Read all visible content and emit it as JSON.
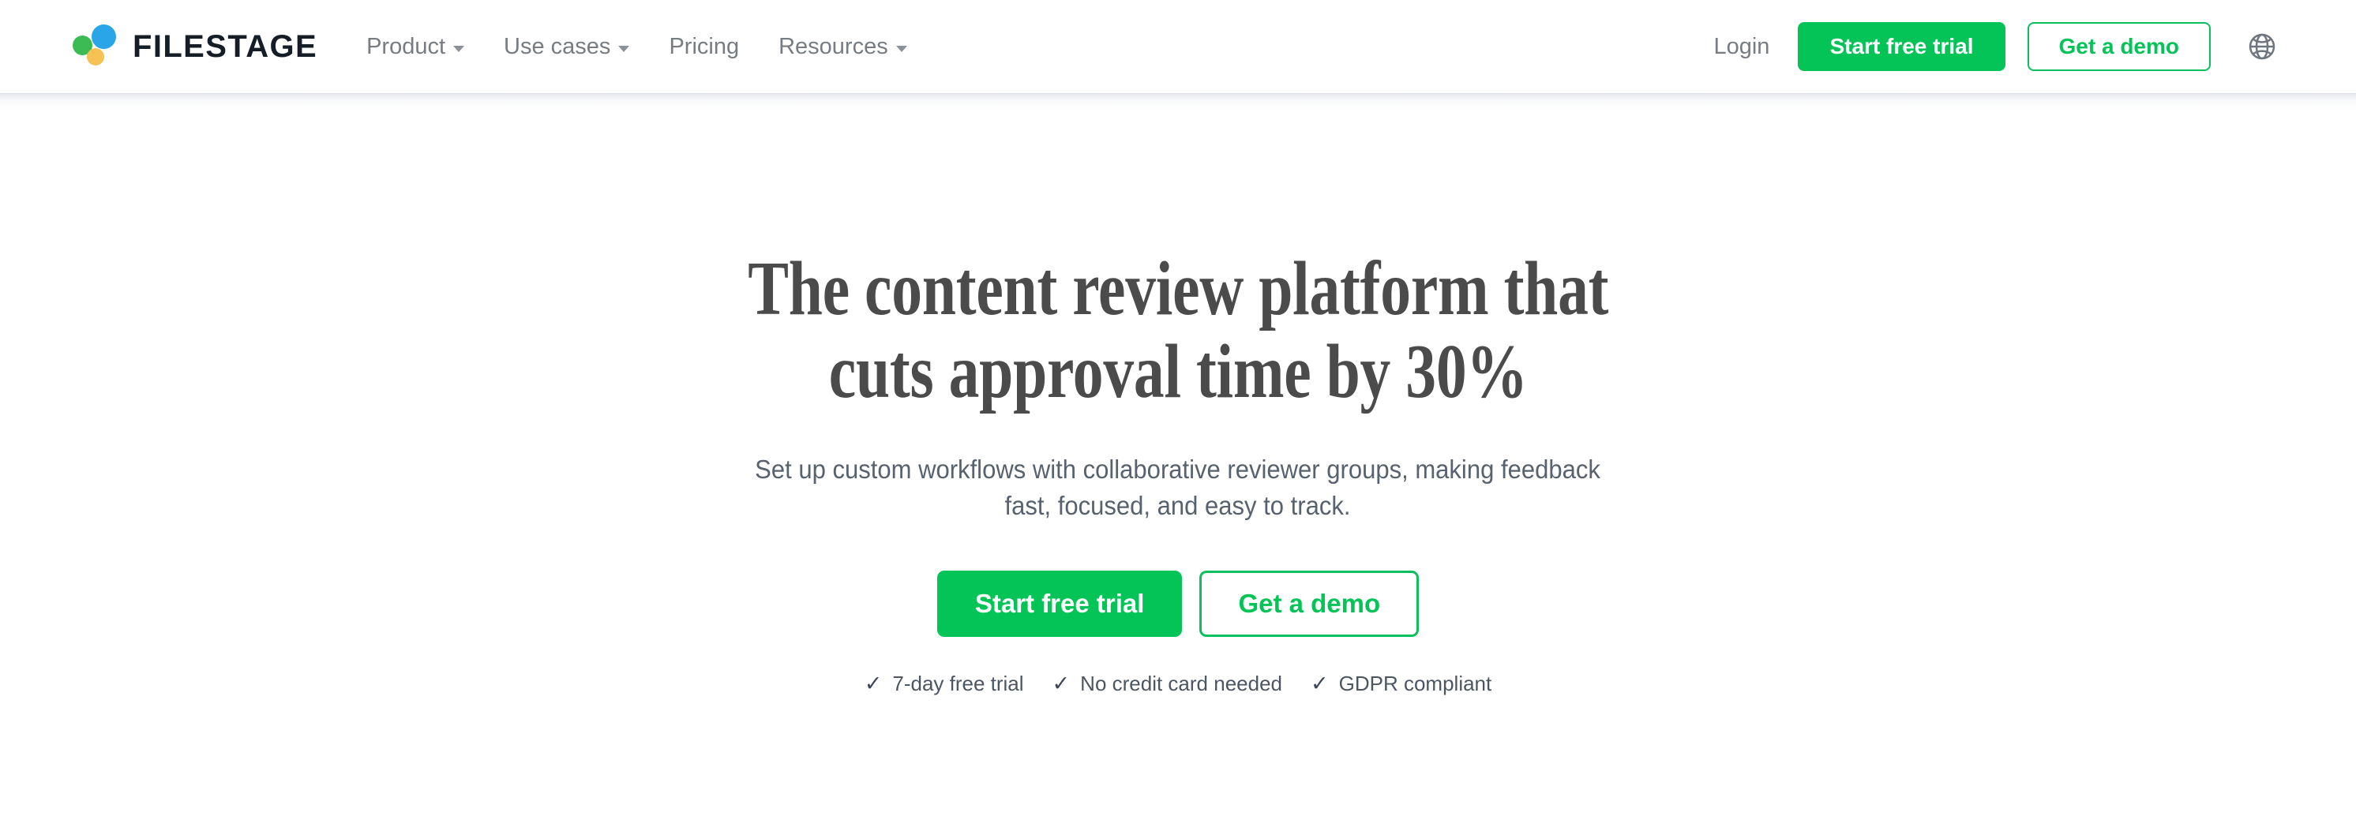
{
  "brand": {
    "wordmark": "FILESTAGE",
    "logo_dots": [
      "green-dot",
      "blue-dot",
      "yellow-dot"
    ],
    "colors": {
      "green": "#3cba54",
      "blue": "#29a5e8",
      "yellow": "#f6c253",
      "wordmark": "#151d26",
      "accent_green": "#05c457"
    }
  },
  "header": {
    "nav": [
      {
        "label": "Product",
        "has_dropdown": true,
        "icon": "chevron-down-icon"
      },
      {
        "label": "Use cases",
        "has_dropdown": true,
        "icon": "chevron-down-icon"
      },
      {
        "label": "Pricing",
        "has_dropdown": false,
        "icon": ""
      },
      {
        "label": "Resources",
        "has_dropdown": true,
        "icon": "chevron-down-icon"
      }
    ],
    "login_label": "Login",
    "start_trial_label": "Start free trial",
    "demo_label": "Get a demo",
    "language_icon": "globe-icon"
  },
  "hero": {
    "title": "The content review platform that\ncuts approval time by 30%",
    "title_line1": "The content review platform that",
    "title_line2": "cuts approval time by 30%",
    "subtitle": "Set up custom workflows with collaborative reviewer groups, making feedback\nfast, focused, and easy to track.",
    "subtitle_line1": "Set up custom workflows with collaborative reviewer groups, making feedback",
    "subtitle_line2": "fast, focused, and easy to track.",
    "primary_cta": "Start free trial",
    "secondary_cta": "Get a demo",
    "checks": [
      {
        "glyph": "✓",
        "label": "7-day free trial"
      },
      {
        "glyph": "✓",
        "label": "No credit card needed"
      },
      {
        "glyph": "✓",
        "label": "GDPR compliant"
      }
    ]
  }
}
